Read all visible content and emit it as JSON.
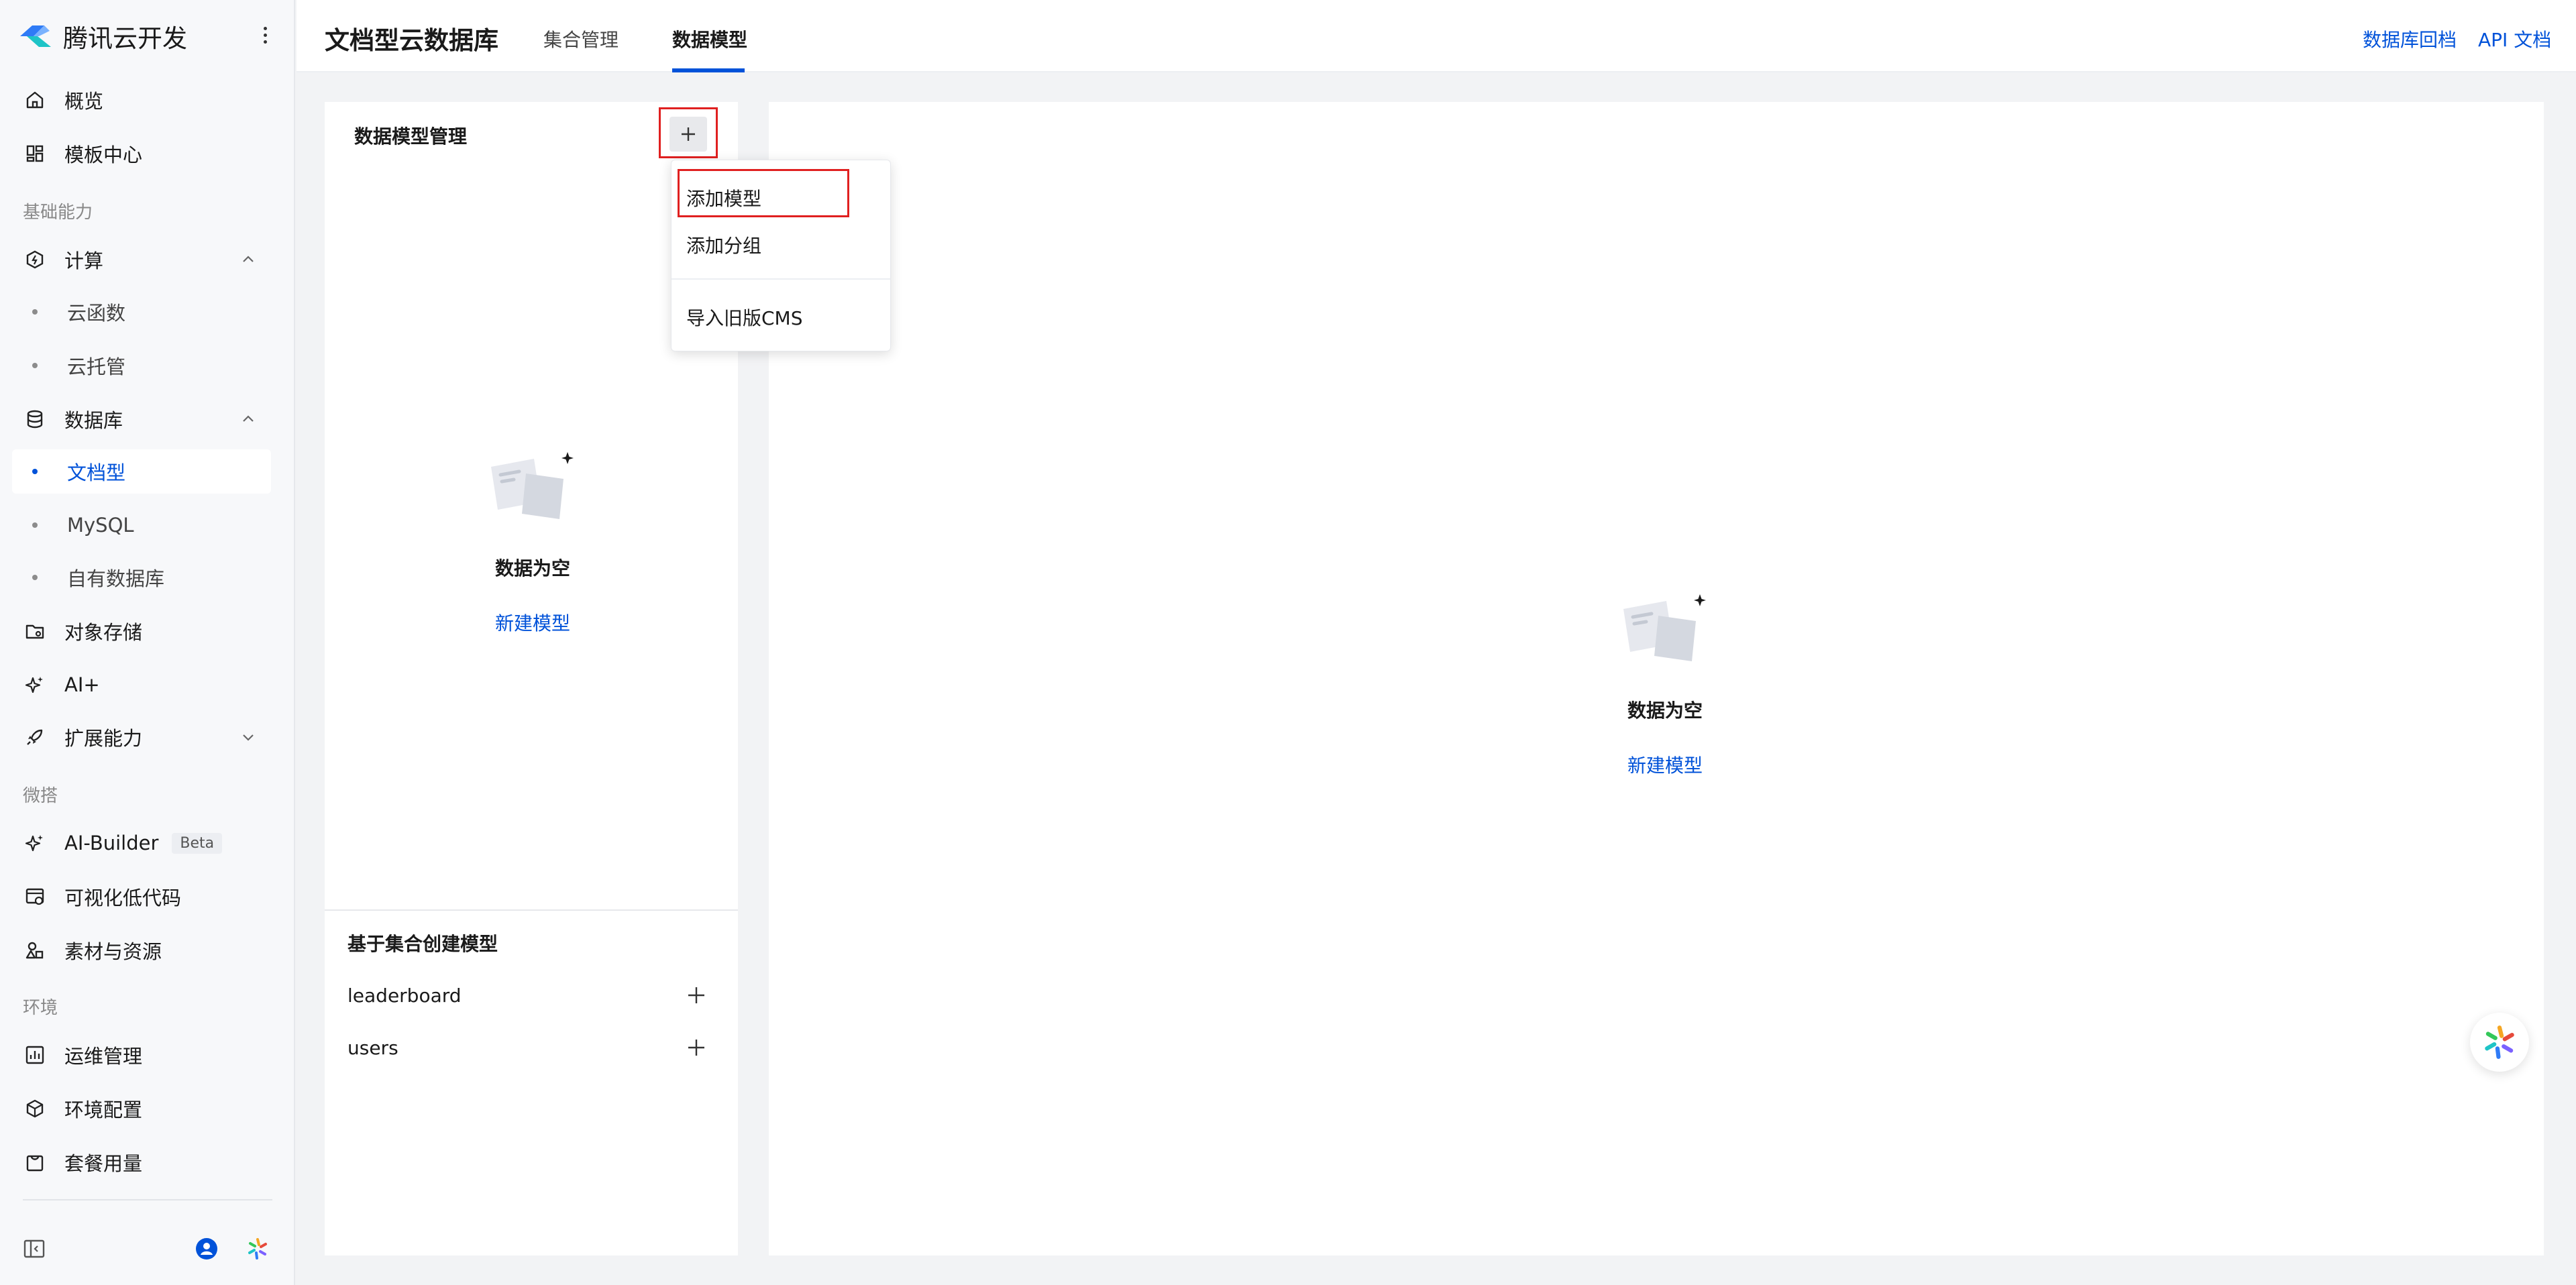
{
  "brand": {
    "name": "腾讯云开发"
  },
  "sidebar": {
    "items": {
      "overview": "概览",
      "templates": "模板中心",
      "compute": "计算",
      "cloud_functions": "云函数",
      "cloud_run": "云托管",
      "database": "数据库",
      "document_db": "文档型",
      "mysql": "MySQL",
      "own_db": "自有数据库",
      "storage": "对象存储",
      "ai": "AI+",
      "extensions": "扩展能力",
      "ai_builder": "AI-Builder",
      "ai_builder_badge": "Beta",
      "lowcode": "可视化低代码",
      "assets": "素材与资源",
      "ops": "运维管理",
      "env_config": "环境配置",
      "usage": "套餐用量"
    },
    "sections": {
      "basic": "基础能力",
      "weda": "微搭",
      "env": "环境"
    },
    "active_item": "文档型"
  },
  "header": {
    "title": "文档型云数据库",
    "tabs": [
      "集合管理",
      "数据模型"
    ],
    "active_tab": "数据模型",
    "links": [
      "数据库回档",
      "API 文档"
    ]
  },
  "left_panel": {
    "title": "数据模型管理",
    "empty_title": "数据为空",
    "empty_action": "新建模型",
    "collections_title": "基于集合创建模型",
    "collections": [
      "leaderboard",
      "users"
    ]
  },
  "dropdown": {
    "items": [
      "添加模型",
      "添加分组",
      "导入旧版CMS"
    ]
  },
  "right_panel": {
    "empty_title": "数据为空",
    "empty_action": "新建模型"
  },
  "colors": {
    "accent": "#0052d9",
    "highlight": "#e02020"
  }
}
